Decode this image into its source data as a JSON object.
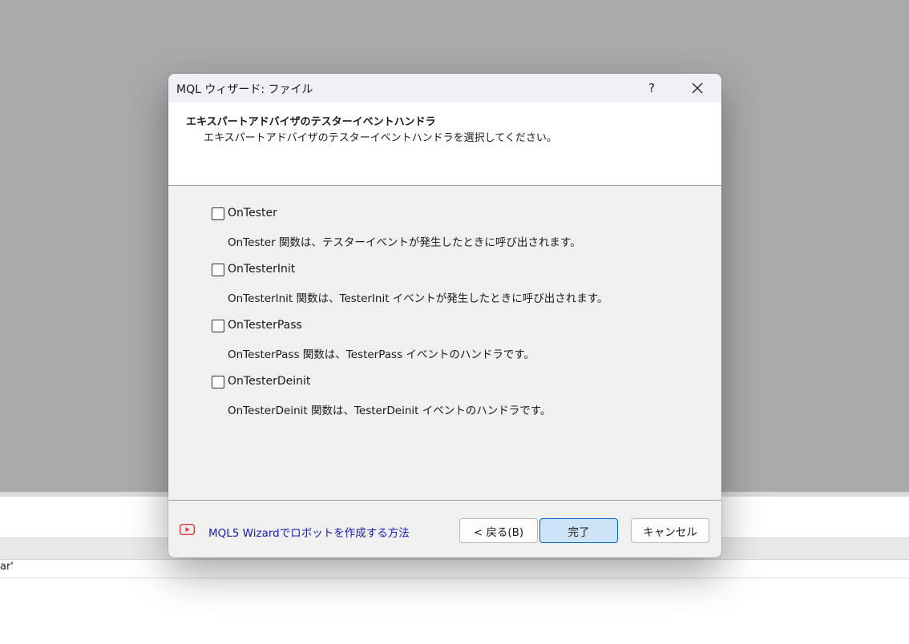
{
  "dialog": {
    "title": "MQL ウィザード: ファイル",
    "help_label": "?",
    "header": {
      "title": "エキスパートアドバイザのテスターイベントハンドラ",
      "subtitle": "エキスパートアドバイザのテスターイベントハンドラを選択してください。"
    },
    "options": [
      {
        "label": "OnTester",
        "checked": false,
        "description": "OnTester 関数は、テスターイベントが発生したときに呼び出されます。"
      },
      {
        "label": "OnTesterInit",
        "checked": false,
        "description": "OnTesterInit 関数は、TesterInit イベントが発生したときに呼び出されます。"
      },
      {
        "label": "OnTesterPass",
        "checked": false,
        "description": "OnTesterPass 関数は、TesterPass イベントのハンドラです。"
      },
      {
        "label": "OnTesterDeinit",
        "checked": false,
        "description": "OnTesterDeinit 関数は、TesterDeinit イベントのハンドラです。"
      }
    ],
    "footer": {
      "link_icon": "youtube-icon",
      "link_text": "MQL5 Wizardでロボットを作成する方法",
      "back_label": "< 戻る(B)",
      "finish_label": "完了",
      "cancel_label": "キャンセル"
    }
  },
  "background": {
    "row_text": "ar'"
  },
  "colors": {
    "link": "#1a1ab5",
    "primary_button_bg": "#cce4f7",
    "primary_button_border": "#0067c0",
    "youtube_red": "#e03b3b"
  }
}
